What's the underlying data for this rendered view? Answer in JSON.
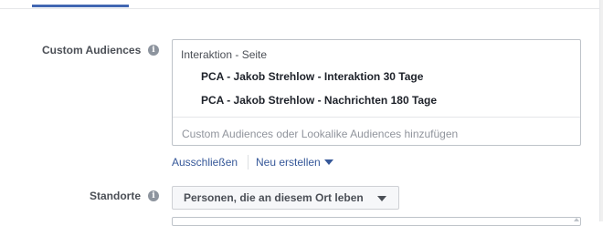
{
  "custom_audiences": {
    "label": "Custom Audiences",
    "info_icon": "i",
    "group_header": "Interaktion - Seite",
    "items": [
      "PCA - Jakob Strehlow - Interaktion 30 Tage",
      "PCA - Jakob Strehlow - Nachrichten 180 Tage"
    ],
    "input_placeholder": "Custom Audiences oder Lookalike Audiences hinzufügen",
    "exclude_link": "Ausschließen",
    "create_new_link": "Neu erstellen"
  },
  "locations": {
    "label": "Standorte",
    "info_icon": "i",
    "dropdown_value": "Personen, die an diesem Ort leben"
  },
  "colors": {
    "link": "#365899",
    "tab_indicator": "#4267b2",
    "label_text": "#4b4f56",
    "border": "#bec3c9"
  },
  "icons": {
    "info": "info-icon",
    "dropdown": "caret-down-icon"
  }
}
